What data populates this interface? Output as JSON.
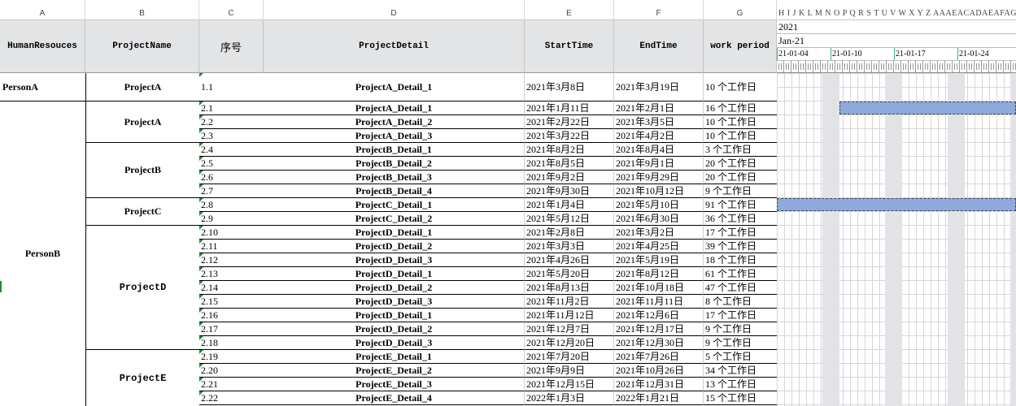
{
  "columns": [
    "A",
    "B",
    "C",
    "D",
    "E",
    "F",
    "G"
  ],
  "gantt_column_letters": "H I J K L M N O P Q R S T U V W X Y Z AAAEACADAEAFAGAH",
  "headers": {
    "human": "HumanResouces",
    "project": "ProjectName",
    "index": "序号",
    "detail": "ProjectDetail",
    "start": "StartTime",
    "end": "EndTime",
    "period": "work period"
  },
  "gantt": {
    "year": "2021",
    "month": "Jan-21",
    "weeks": [
      "21-01-04",
      "21-01-10",
      "21-01-17",
      "21-01-24"
    ]
  },
  "persons": [
    "PersonA",
    "PersonB"
  ],
  "project_groups": [
    "ProjectA",
    "ProjectA",
    "ProjectB",
    "ProjectC",
    "ProjectD",
    "ProjectE"
  ],
  "rows": [
    {
      "idx": "1.1",
      "detail": "ProjectA_Detail_1",
      "start": "2021年3月8日",
      "end": "2021年3月19日",
      "period": "10 个工作日"
    },
    {
      "idx": "2.1",
      "detail": "ProjectA_Detail_1",
      "start": "2021年1月11日",
      "end": "2021年2月1日",
      "period": "16 个工作日"
    },
    {
      "idx": "2.2",
      "detail": "ProjectA_Detail_2",
      "start": "2021年2月22日",
      "end": "2021年3月5日",
      "period": "10 个工作日"
    },
    {
      "idx": "2.3",
      "detail": "ProjectA_Detail_3",
      "start": "2021年3月22日",
      "end": "2021年4月2日",
      "period": "10 个工作日"
    },
    {
      "idx": "2.4",
      "detail": "ProjectB_Detail_1",
      "start": "2021年8月2日",
      "end": "2021年8月4日",
      "period": "3 个工作日"
    },
    {
      "idx": "2.5",
      "detail": "ProjectB_Detail_2",
      "start": "2021年8月5日",
      "end": "2021年9月1日",
      "period": "20 个工作日"
    },
    {
      "idx": "2.6",
      "detail": "ProjectB_Detail_3",
      "start": "2021年9月2日",
      "end": "2021年9月29日",
      "period": "20 个工作日"
    },
    {
      "idx": "2.7",
      "detail": "ProjectB_Detail_4",
      "start": "2021年9月30日",
      "end": "2021年10月12日",
      "period": "9 个工作日"
    },
    {
      "idx": "2.8",
      "detail": "ProjectC_Detail_1",
      "start": "2021年1月4日",
      "end": "2021年5月10日",
      "period": "91 个工作日"
    },
    {
      "idx": "2.9",
      "detail": "ProjectC_Detail_2",
      "start": "2021年5月12日",
      "end": "2021年6月30日",
      "period": "36 个工作日"
    },
    {
      "idx": "2.10",
      "detail": "ProjectD_Detail_1",
      "start": "2021年2月8日",
      "end": "2021年3月2日",
      "period": "17 个工作日"
    },
    {
      "idx": "2.11",
      "detail": "ProjectD_Detail_2",
      "start": "2021年3月3日",
      "end": "2021年4月25日",
      "period": "39 个工作日"
    },
    {
      "idx": "2.12",
      "detail": "ProjectD_Detail_3",
      "start": "2021年4月26日",
      "end": "2021年5月19日",
      "period": "18 个工作日"
    },
    {
      "idx": "2.13",
      "detail": "ProjectD_Detail_1",
      "start": "2021年5月20日",
      "end": "2021年8月12日",
      "period": "61 个工作日"
    },
    {
      "idx": "2.14",
      "detail": "ProjectD_Detail_2",
      "start": "2021年8月13日",
      "end": "2021年10月18日",
      "period": "47 个工作日"
    },
    {
      "idx": "2.15",
      "detail": "ProjectD_Detail_3",
      "start": "2021年11月2日",
      "end": "2021年11月11日",
      "period": "8 个工作日"
    },
    {
      "idx": "2.16",
      "detail": "ProjectD_Detail_1",
      "start": "2021年11月12日",
      "end": "2021年12月6日",
      "period": "17 个工作日"
    },
    {
      "idx": "2.17",
      "detail": "ProjectD_Detail_2",
      "start": "2021年12月7日",
      "end": "2021年12月17日",
      "period": "9 个工作日"
    },
    {
      "idx": "2.18",
      "detail": "ProjectD_Detail_3",
      "start": "2021年12月20日",
      "end": "2021年12月30日",
      "period": "9 个工作日"
    },
    {
      "idx": "2.19",
      "detail": "ProjectE_Detail_1",
      "start": "2021年7月20日",
      "end": "2021年7月26日",
      "period": "5 个工作日"
    },
    {
      "idx": "2.20",
      "detail": "ProjectE_Detail_2",
      "start": "2021年9月9日",
      "end": "2021年10月26日",
      "period": "34 个工作日"
    },
    {
      "idx": "2.21",
      "detail": "ProjectE_Detail_3",
      "start": "2021年12月15日",
      "end": "2021年12月31日",
      "period": "13 个工作日"
    },
    {
      "idx": "2.22",
      "detail": "ProjectE_Detail_4",
      "start": "2022年1月3日",
      "end": "2022年1月21日",
      "period": "15 个工作日"
    }
  ]
}
